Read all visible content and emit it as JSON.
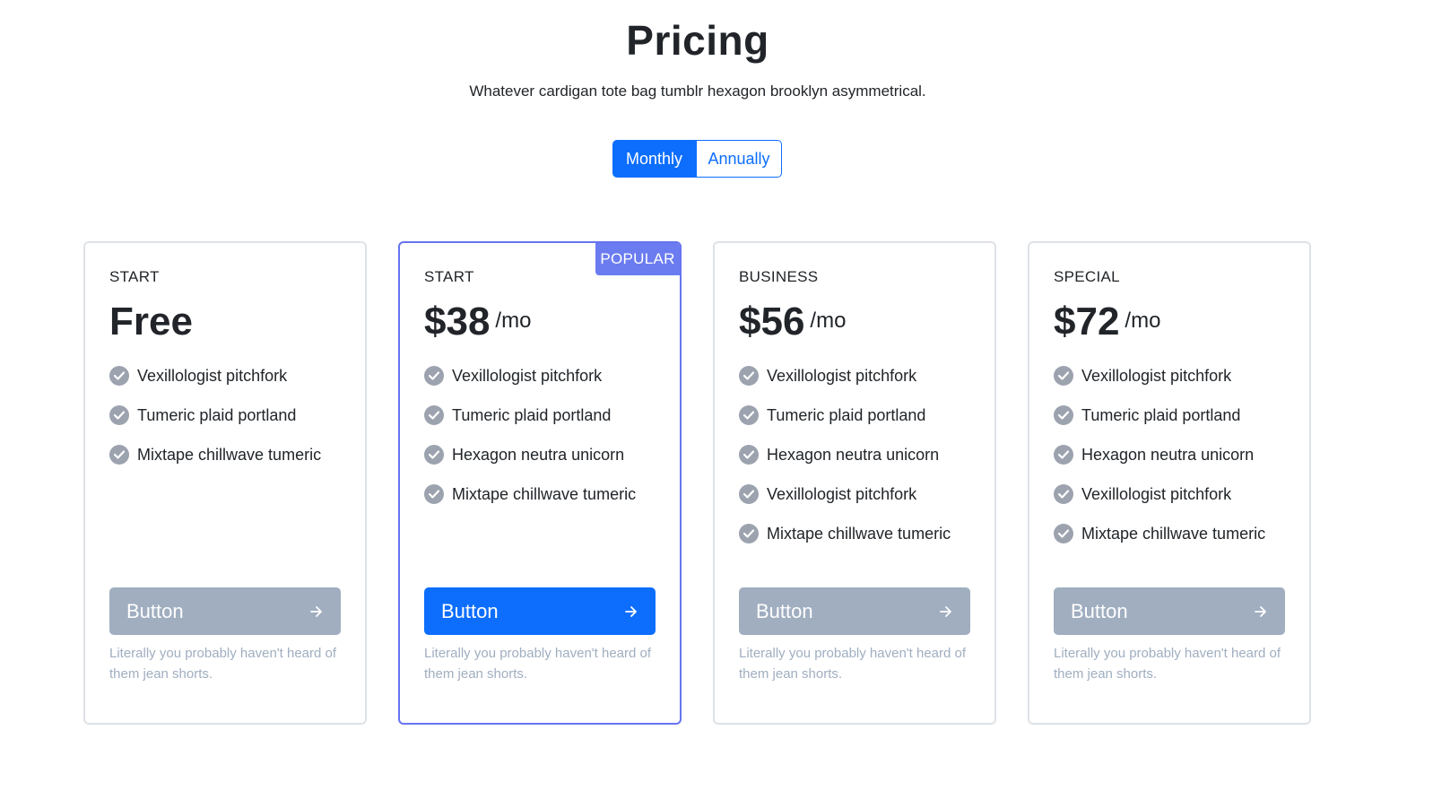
{
  "header": {
    "title": "Pricing",
    "subtitle": "Whatever cardigan tote bag tumblr hexagon brooklyn asymmetrical."
  },
  "billing_toggle": {
    "monthly_label": "Monthly",
    "annually_label": "Annually",
    "selected": "Monthly"
  },
  "colors": {
    "accent": "#0d6efd",
    "popular_border": "#6674f0",
    "badge": "#6b7cf0",
    "muted_button": "#a0aec0",
    "check_icon": "#9ca3af"
  },
  "plans": [
    {
      "name": "START",
      "price": "Free",
      "period": "",
      "popular": false,
      "features": [
        "Vexillologist pitchfork",
        "Tumeric plaid portland",
        "Mixtape chillwave tumeric"
      ],
      "button_label": "Button",
      "note": "Literally you probably haven't heard of them jean shorts."
    },
    {
      "name": "START",
      "price": "$38",
      "period": "/mo",
      "popular": true,
      "badge": "POPULAR",
      "features": [
        "Vexillologist pitchfork",
        "Tumeric plaid portland",
        "Hexagon neutra unicorn",
        "Mixtape chillwave tumeric"
      ],
      "button_label": "Button",
      "note": "Literally you probably haven't heard of them jean shorts."
    },
    {
      "name": "BUSINESS",
      "price": "$56",
      "period": "/mo",
      "popular": false,
      "features": [
        "Vexillologist pitchfork",
        "Tumeric plaid portland",
        "Hexagon neutra unicorn",
        "Vexillologist pitchfork",
        "Mixtape chillwave tumeric"
      ],
      "button_label": "Button",
      "note": "Literally you probably haven't heard of them jean shorts."
    },
    {
      "name": "SPECIAL",
      "price": "$72",
      "period": "/mo",
      "popular": false,
      "features": [
        "Vexillologist pitchfork",
        "Tumeric plaid portland",
        "Hexagon neutra unicorn",
        "Vexillologist pitchfork",
        "Mixtape chillwave tumeric"
      ],
      "button_label": "Button",
      "note": "Literally you probably haven't heard of them jean shorts."
    }
  ],
  "icons": {
    "feature": "check-circle-icon",
    "button": "arrow-right-icon"
  }
}
